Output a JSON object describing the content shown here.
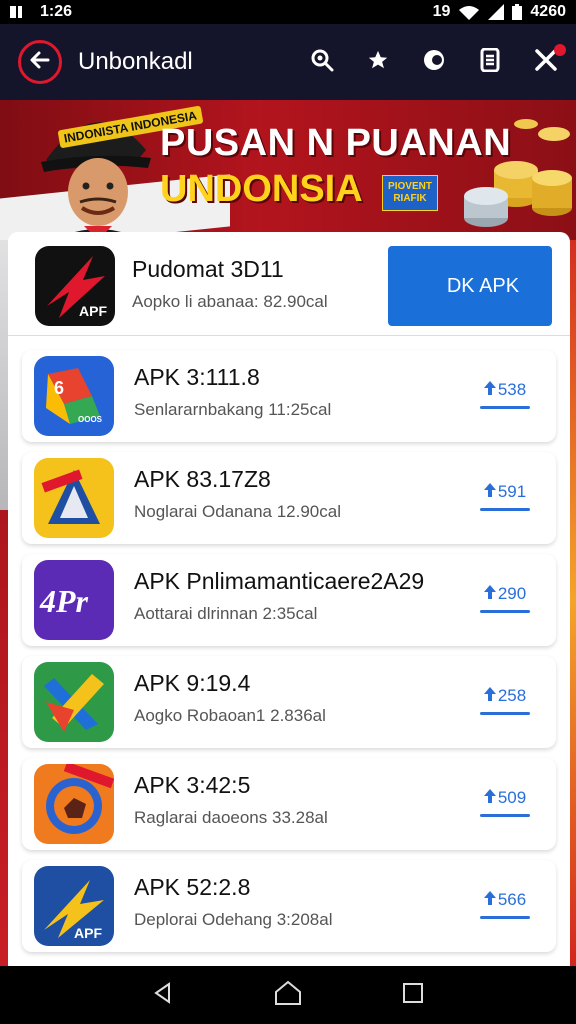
{
  "status_bar": {
    "time": "1:26",
    "battery": "4260",
    "network_label": "19"
  },
  "app_bar": {
    "title": "Unbonkadl"
  },
  "banner": {
    "title_line1": "PUSAN N PUANAN",
    "title_line2": "UNDONSIA",
    "hat_text": "INDONISTA INDONESIA",
    "badge_line1": "PIOVENT",
    "badge_line2": "RIAFIK"
  },
  "top_item": {
    "name": "Pudomat 3D11",
    "subtitle": "Aopko li abanaa: 82.90cal",
    "icon_label": "APF",
    "download_label": "DK APK"
  },
  "items": [
    {
      "name": "APK 3:111.8",
      "subtitle": "Senlararnbakang 11:25cal",
      "size": "538",
      "icon_label": "6",
      "icon_sub": "OOOS",
      "colors": [
        "#2563d6",
        "#e8432f",
        "#fbbc05",
        "#34a853"
      ]
    },
    {
      "name": "APK 83.17Z8",
      "subtitle": "Noglarai Odanana 12.90cal",
      "size": "591",
      "icon_label": "",
      "icon_sub": "",
      "colors": [
        "#f4c21b",
        "#1f4fa2"
      ]
    },
    {
      "name": "APK Pnlimamanticaere2A29",
      "subtitle": "Aottarai dlrinnan 2:35cal",
      "size": "290",
      "icon_label": "4Pr",
      "icon_sub": "",
      "colors": [
        "#5b2bb5"
      ]
    },
    {
      "name": "APK 9:19.4",
      "subtitle": "Aogko Robaoan1 2.836al",
      "size": "258",
      "icon_label": "",
      "icon_sub": "",
      "colors": [
        "#2e9a48"
      ]
    },
    {
      "name": "APK 3:42:5",
      "subtitle": "Raglarai daoeons 33.28al",
      "size": "509",
      "icon_label": "",
      "icon_sub": "",
      "colors": [
        "#f07a1e",
        "#2a63cf"
      ]
    },
    {
      "name": "APK 52:2.8",
      "subtitle": "Deplorai Odehang 3:208al",
      "size": "566",
      "icon_label": "APF",
      "icon_sub": "",
      "colors": [
        "#1f4fa2",
        "#f4c21b"
      ]
    }
  ],
  "nav_bar": {
    "back": "back-icon",
    "home": "home-icon",
    "recents": "recents-icon"
  }
}
